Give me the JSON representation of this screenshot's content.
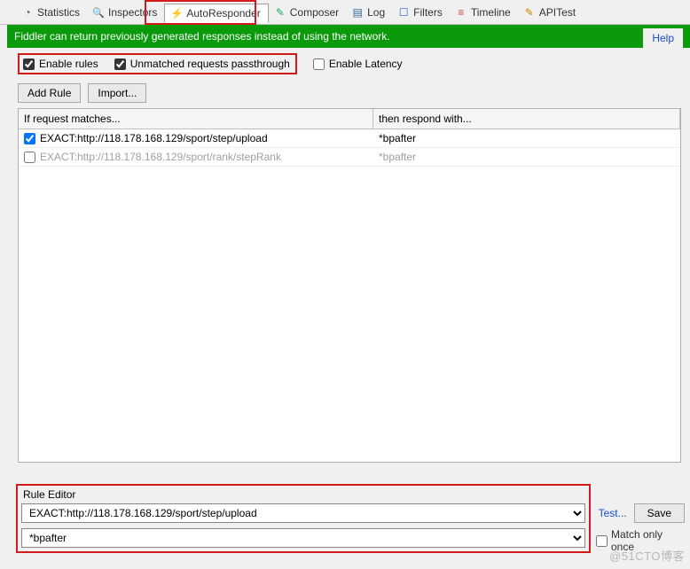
{
  "tabs": {
    "statistics": "Statistics",
    "inspectors": "Inspectors",
    "autoresponder": "AutoResponder",
    "composer": "Composer",
    "log": "Log",
    "filters": "Filters",
    "timeline": "Timeline",
    "apitest": "APITest"
  },
  "banner": {
    "text": "Fiddler can return previously generated responses instead of using the network.",
    "help": "Help"
  },
  "options": {
    "enable_rules": "Enable rules",
    "unmatched_passthrough": "Unmatched requests passthrough",
    "enable_latency": "Enable Latency"
  },
  "buttons": {
    "add_rule": "Add Rule",
    "import": "Import..."
  },
  "grid": {
    "col_if": "If request matches...",
    "col_then": "then respond with...",
    "rows": [
      {
        "enabled": true,
        "match": "EXACT:http://118.178.168.129/sport/step/upload",
        "respond": "*bpafter"
      },
      {
        "enabled": false,
        "match": "EXACT:http://118.178.168.129/sport/rank/stepRank",
        "respond": "*bpafter"
      }
    ]
  },
  "rule_editor": {
    "title": "Rule Editor",
    "match_value": "EXACT:http://118.178.168.129/sport/step/upload",
    "respond_value": "*bpafter"
  },
  "right": {
    "test": "Test...",
    "save": "Save",
    "match_only_once": "Match only once"
  },
  "watermark": "@51CTO博客"
}
